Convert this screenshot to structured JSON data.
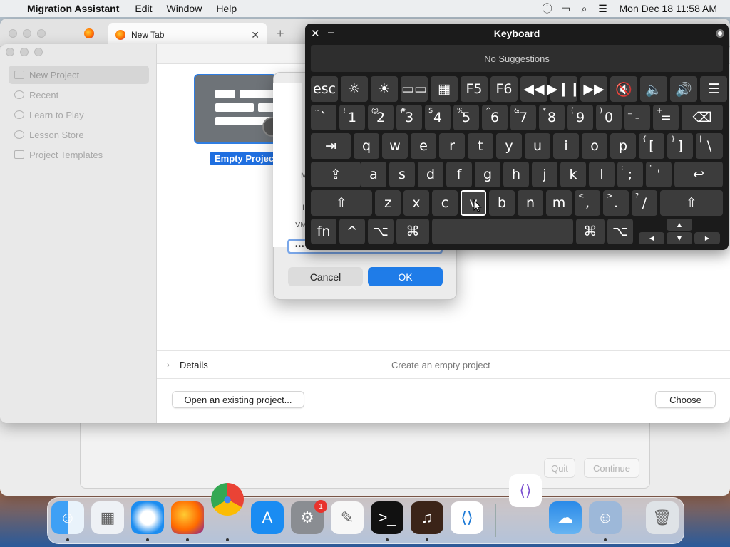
{
  "menubar": {
    "apple_glyph": "",
    "app_name": "Migration Assistant",
    "menus": [
      "Edit",
      "Window",
      "Help"
    ],
    "clock": "Mon Dec 18  11:58 AM",
    "status_icons": [
      "accessibility-icon",
      "screen-mirroring-icon",
      "spotlight-search-icon",
      "control-center-icon"
    ]
  },
  "browser": {
    "tab_title": "New Tab",
    "close_glyph": "✕",
    "new_tab_glyph": "+"
  },
  "project_window": {
    "sidebar": [
      {
        "label": "New Project",
        "selected": true
      },
      {
        "label": "Recent",
        "selected": false
      },
      {
        "label": "Learn to Play",
        "selected": false
      },
      {
        "label": "Lesson Store",
        "selected": false
      },
      {
        "label": "Project Templates",
        "selected": false
      }
    ],
    "template_label": "Empty Project",
    "details_label": "Details",
    "details_desc": "Create an empty project",
    "open_existing_label": "Open an existing project...",
    "choose_label": "Choose"
  },
  "dialog": {
    "frag_m": "M",
    "frag_i": "I",
    "frag_vm": "VM",
    "password_mask": "•••",
    "cancel_label": "Cancel",
    "ok_label": "OK"
  },
  "migration": {
    "quit_label": "Quit",
    "continue_label": "Continue"
  },
  "keyboard": {
    "title": "Keyboard",
    "suggestions": "No Suggestions",
    "close_glyph": "✕",
    "minimize_glyph": "–",
    "row0": [
      {
        "label": "esc",
        "name": "key-esc"
      },
      {
        "label": "☼",
        "name": "key-brightness-down"
      },
      {
        "label": "☀",
        "name": "key-brightness-up"
      },
      {
        "label": "▭▭",
        "name": "key-mission-control"
      },
      {
        "label": "▦",
        "name": "key-launchpad"
      },
      {
        "label": "F5",
        "name": "key-f5"
      },
      {
        "label": "F6",
        "name": "key-f6"
      },
      {
        "label": "◀◀",
        "name": "key-rewind"
      },
      {
        "label": "▶❙❙",
        "name": "key-play-pause"
      },
      {
        "label": "▶▶",
        "name": "key-fast-forward"
      },
      {
        "label": "🔇",
        "name": "key-mute"
      },
      {
        "label": "🔈",
        "name": "key-volume-down"
      },
      {
        "label": "🔊",
        "name": "key-volume-up"
      },
      {
        "label": "☰",
        "name": "key-dictation"
      }
    ],
    "row1": [
      {
        "sub": "~",
        "label": "`"
      },
      {
        "sub": "!",
        "label": "1"
      },
      {
        "sub": "@",
        "label": "2"
      },
      {
        "sub": "#",
        "label": "3"
      },
      {
        "sub": "$",
        "label": "4"
      },
      {
        "sub": "%",
        "label": "5"
      },
      {
        "sub": "^",
        "label": "6"
      },
      {
        "sub": "&",
        "label": "7"
      },
      {
        "sub": "*",
        "label": "8"
      },
      {
        "sub": "(",
        "label": "9"
      },
      {
        "sub": ")",
        "label": "0"
      },
      {
        "sub": "_",
        "label": "-"
      },
      {
        "sub": "+",
        "label": "="
      },
      {
        "sub": "",
        "label": "⌫"
      }
    ],
    "row2": [
      {
        "sub": "",
        "label": "⇥"
      },
      {
        "sub": "",
        "label": "q"
      },
      {
        "sub": "",
        "label": "w"
      },
      {
        "sub": "",
        "label": "e"
      },
      {
        "sub": "",
        "label": "r"
      },
      {
        "sub": "",
        "label": "t"
      },
      {
        "sub": "",
        "label": "y"
      },
      {
        "sub": "",
        "label": "u"
      },
      {
        "sub": "",
        "label": "i"
      },
      {
        "sub": "",
        "label": "o"
      },
      {
        "sub": "",
        "label": "p"
      },
      {
        "sub": "{",
        "label": "["
      },
      {
        "sub": "}",
        "label": "]"
      },
      {
        "sub": "|",
        "label": "\\"
      }
    ],
    "row3": [
      {
        "sub": "",
        "label": "⇪"
      },
      {
        "sub": "",
        "label": "a"
      },
      {
        "sub": "",
        "label": "s"
      },
      {
        "sub": "",
        "label": "d"
      },
      {
        "sub": "",
        "label": "f"
      },
      {
        "sub": "",
        "label": "g"
      },
      {
        "sub": "",
        "label": "h"
      },
      {
        "sub": "",
        "label": "j"
      },
      {
        "sub": "",
        "label": "k"
      },
      {
        "sub": "",
        "label": "l"
      },
      {
        "sub": ":",
        "label": ";"
      },
      {
        "sub": "\"",
        "label": "'"
      },
      {
        "sub": "",
        "label": "↩"
      }
    ],
    "row4": [
      {
        "sub": "",
        "label": "⇧"
      },
      {
        "sub": "",
        "label": "z"
      },
      {
        "sub": "",
        "label": "x"
      },
      {
        "sub": "",
        "label": "c"
      },
      {
        "sub": "",
        "label": "v"
      },
      {
        "sub": "",
        "label": "b"
      },
      {
        "sub": "",
        "label": "n"
      },
      {
        "sub": "",
        "label": "m"
      },
      {
        "sub": "<",
        "label": ","
      },
      {
        "sub": ">",
        "label": "."
      },
      {
        "sub": "?",
        "label": "/"
      },
      {
        "sub": "",
        "label": "⇧"
      }
    ],
    "row5": [
      {
        "label": "fn"
      },
      {
        "label": "^"
      },
      {
        "label": "⌥"
      },
      {
        "label": "⌘"
      },
      {
        "label": ""
      },
      {
        "label": "⌘"
      },
      {
        "label": "⌥"
      }
    ],
    "arrows": {
      "up": "▲",
      "left": "◀",
      "down": "▼",
      "right": "▶"
    }
  },
  "dock": {
    "apps": [
      "Finder",
      "Launchpad",
      "Safari",
      "Firefox",
      "Google Chrome",
      "App Store",
      "System Settings",
      "TextEdit",
      "Terminal",
      "GarageBand",
      "Visual Studio Code",
      "Weather",
      "Migration Assistant",
      "Trash"
    ],
    "settings_badge": "1"
  },
  "colors": {
    "accent": "#1f7ce8",
    "keyboard_bg": "#1b1b1b",
    "key_bg": "#3c3c3c"
  }
}
